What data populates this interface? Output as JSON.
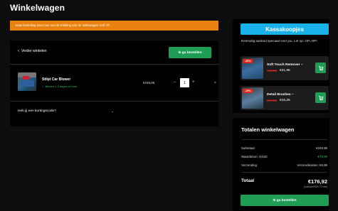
{
  "page": {
    "title": "Winkelwagen"
  },
  "notice": {
    "text": "Jouw bestelling doet mee met de trekking van de Volkswagen Golf 7R"
  },
  "cart": {
    "back_label": "Verder winkelen",
    "checkout_label": "Ik ga bestellen",
    "item": {
      "name": "Stilpt Car Blower",
      "shipping": "✓ Binnen 1-2 dagen in huis",
      "price": "€249,95",
      "qty_minus": "–",
      "quantity": "1",
      "qty_plus": "+",
      "remove": "×"
    },
    "coupon_label": "Heb jij een kortingscode?",
    "coupon_chevron": "⌄"
  },
  "kassa": {
    "title": "Kassakoopjes",
    "offer_text": "Eenmalig aanbod speciaal voor jou. Let op: OP=OP!",
    "items": [
      {
        "badge": "-20%",
        "name": "Soft Touch Remover –",
        "old_price": "€39,95",
        "new_price": "€31,96",
        "cart_icon": "cart-icon"
      },
      {
        "badge": "-15%",
        "name": "Detail Brushes –",
        "old_price": "€17,95",
        "new_price": "€15,25",
        "cart_icon": "cart-icon"
      }
    ]
  },
  "totals": {
    "title": "Totalen winkelwagen",
    "rows": [
      {
        "label": "Subtotaal",
        "value": "€249,95"
      },
      {
        "label": "Waardebon: rick32",
        "value": "-€79,99"
      },
      {
        "label": "Verzending",
        "value": "Verzendkosten: €6,95"
      }
    ],
    "total_label": "Totaal",
    "total_value": "€176,92",
    "vat_note": "(inclusief €30,71 btw)",
    "checkout_label": "Ik ga bestellen"
  },
  "colors": {
    "accent_green": "#1f9d55",
    "notice_orange": "#e8820f",
    "kassa_blue": "#1ab0e8",
    "discount_red": "#e0281c"
  }
}
